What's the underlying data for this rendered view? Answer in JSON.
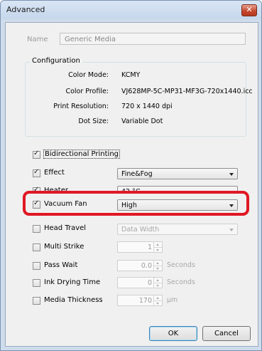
{
  "window": {
    "title": "Advanced",
    "close_label": "✕"
  },
  "name": {
    "label": "Name",
    "value": "Generic Media"
  },
  "configuration": {
    "legend": "Configuration",
    "rows": [
      {
        "label": "Color Mode:",
        "value": "KCMY"
      },
      {
        "label": "Color Profile:",
        "value": "VJ628MP-5C-MP31-MF3G-720x1440.icc"
      },
      {
        "label": "Print Resolution:",
        "value": "720 x 1440 dpi"
      },
      {
        "label": "Dot Size:",
        "value": "Variable Dot"
      }
    ]
  },
  "options": {
    "bidirectional": {
      "label": "Bidirectional Printing",
      "checked": true
    },
    "effect": {
      "label": "Effect",
      "checked": true,
      "value": "Fine&Fog"
    },
    "heater": {
      "label": "Heater",
      "checked": true,
      "value": "42 °C"
    },
    "vacuum_fan": {
      "label": "Vacuum Fan",
      "checked": true,
      "value": "High"
    },
    "head_travel": {
      "label": "Head Travel",
      "checked": false,
      "value": "Data Width"
    },
    "multi_strike": {
      "label": "Multi Strike",
      "checked": false,
      "value": "1"
    },
    "pass_wait": {
      "label": "Pass Wait",
      "checked": false,
      "value": "0.0",
      "unit": "Seconds"
    },
    "ink_drying": {
      "label": "Ink Drying Time",
      "checked": false,
      "value": "0",
      "unit": "Seconds"
    },
    "media_thickness": {
      "label": "Media Thickness",
      "checked": false,
      "value": "170",
      "unit": "µm"
    }
  },
  "buttons": {
    "ok": "OK",
    "cancel": "Cancel"
  },
  "colors": {
    "highlight": "#e01824",
    "title_bar": "#cfdcec"
  }
}
